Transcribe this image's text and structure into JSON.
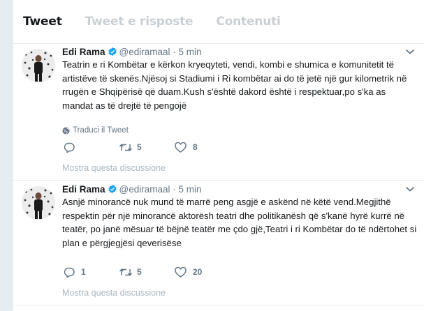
{
  "tabs": [
    {
      "label": "Tweet",
      "active": true
    },
    {
      "label": "Tweet e risposte",
      "active": false
    },
    {
      "label": "Contenuti",
      "active": false
    }
  ],
  "tweets": [
    {
      "name": "Edi Rama",
      "handle": "@ediramaal",
      "dot": "·",
      "time": "5 min",
      "text": "Teatrin e ri Kombëtar e kërkon kryeqyteti, vendi, kombi e shumica e komunitetit të artistëve të skenës.Njësoj si Stadiumi i Ri kombëtar ai do të jetë një gur kilometrik në rrugën e Shqipërisë që duam.Kush s'është dakord është i respektuar,po s'ka as mandat as të drejtë të pengojë",
      "translate": "Traduci il Tweet",
      "replies": "",
      "retweets": "5",
      "likes": "8",
      "thread": "Mostra questa discussione"
    },
    {
      "name": "Edi Rama",
      "handle": "@ediramaal",
      "dot": "·",
      "time": "5 min",
      "text": "Asnjë minorancë nuk mund të marrë peng asgjë e askënd në këtë vend.Megjithë respektin për një minorancë aktorësh teatri dhe politikanësh që s'kanë hyrë kurrë në teatër, po janë mësuar të bëjnë teatër me çdo gjë,Teatri i ri Kombëtar do të ndërtohet si plan e përgjegjësi qeverisëse",
      "replies": "1",
      "retweets": "5",
      "likes": "20",
      "thread": "Mostra questa discussione"
    }
  ],
  "colors": {
    "accent": "#1da1f2",
    "muted": "#657786",
    "faint": "#aab8c2",
    "background": "#e6ecf0"
  },
  "icons": [
    "verified-badge-icon",
    "chevron-down-icon",
    "globe-icon",
    "reply-icon",
    "retweet-icon",
    "like-icon"
  ]
}
